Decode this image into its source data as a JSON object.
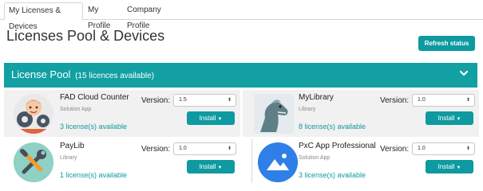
{
  "tabs": [
    "My Licenses & Devices",
    "My Profile",
    "Company Profile"
  ],
  "page": {
    "title": "Licenses Pool & Devices",
    "refresh_label": "Refresh status"
  },
  "pool": {
    "title": "License Pool",
    "count": "(15 licences available)"
  },
  "version_label": "Version:",
  "install_label": "Install",
  "apps": [
    {
      "name": "FAD Cloud Counter",
      "category": "Solution App",
      "availability": "3 license(s) available",
      "version": "1.5",
      "icon": "gears-face-icon"
    },
    {
      "name": "MyLibrary",
      "category": "Library",
      "availability": "8 license(s) available",
      "version": "1.0",
      "icon": "dinosaur-icon"
    },
    {
      "name": "PayLib",
      "category": "Library",
      "availability": "1 license(s) available",
      "version": "1.0",
      "icon": "wrench-screwdriver-icon"
    },
    {
      "name": "PxC App Professional",
      "category": "Solution App",
      "availability": "3 license(s) available",
      "version": "1.0",
      "icon": "image-icon"
    }
  ],
  "colors": {
    "accent": "#0e9aa0",
    "pool_bar": "#12a0a3",
    "availability": "#0f9a9e"
  }
}
